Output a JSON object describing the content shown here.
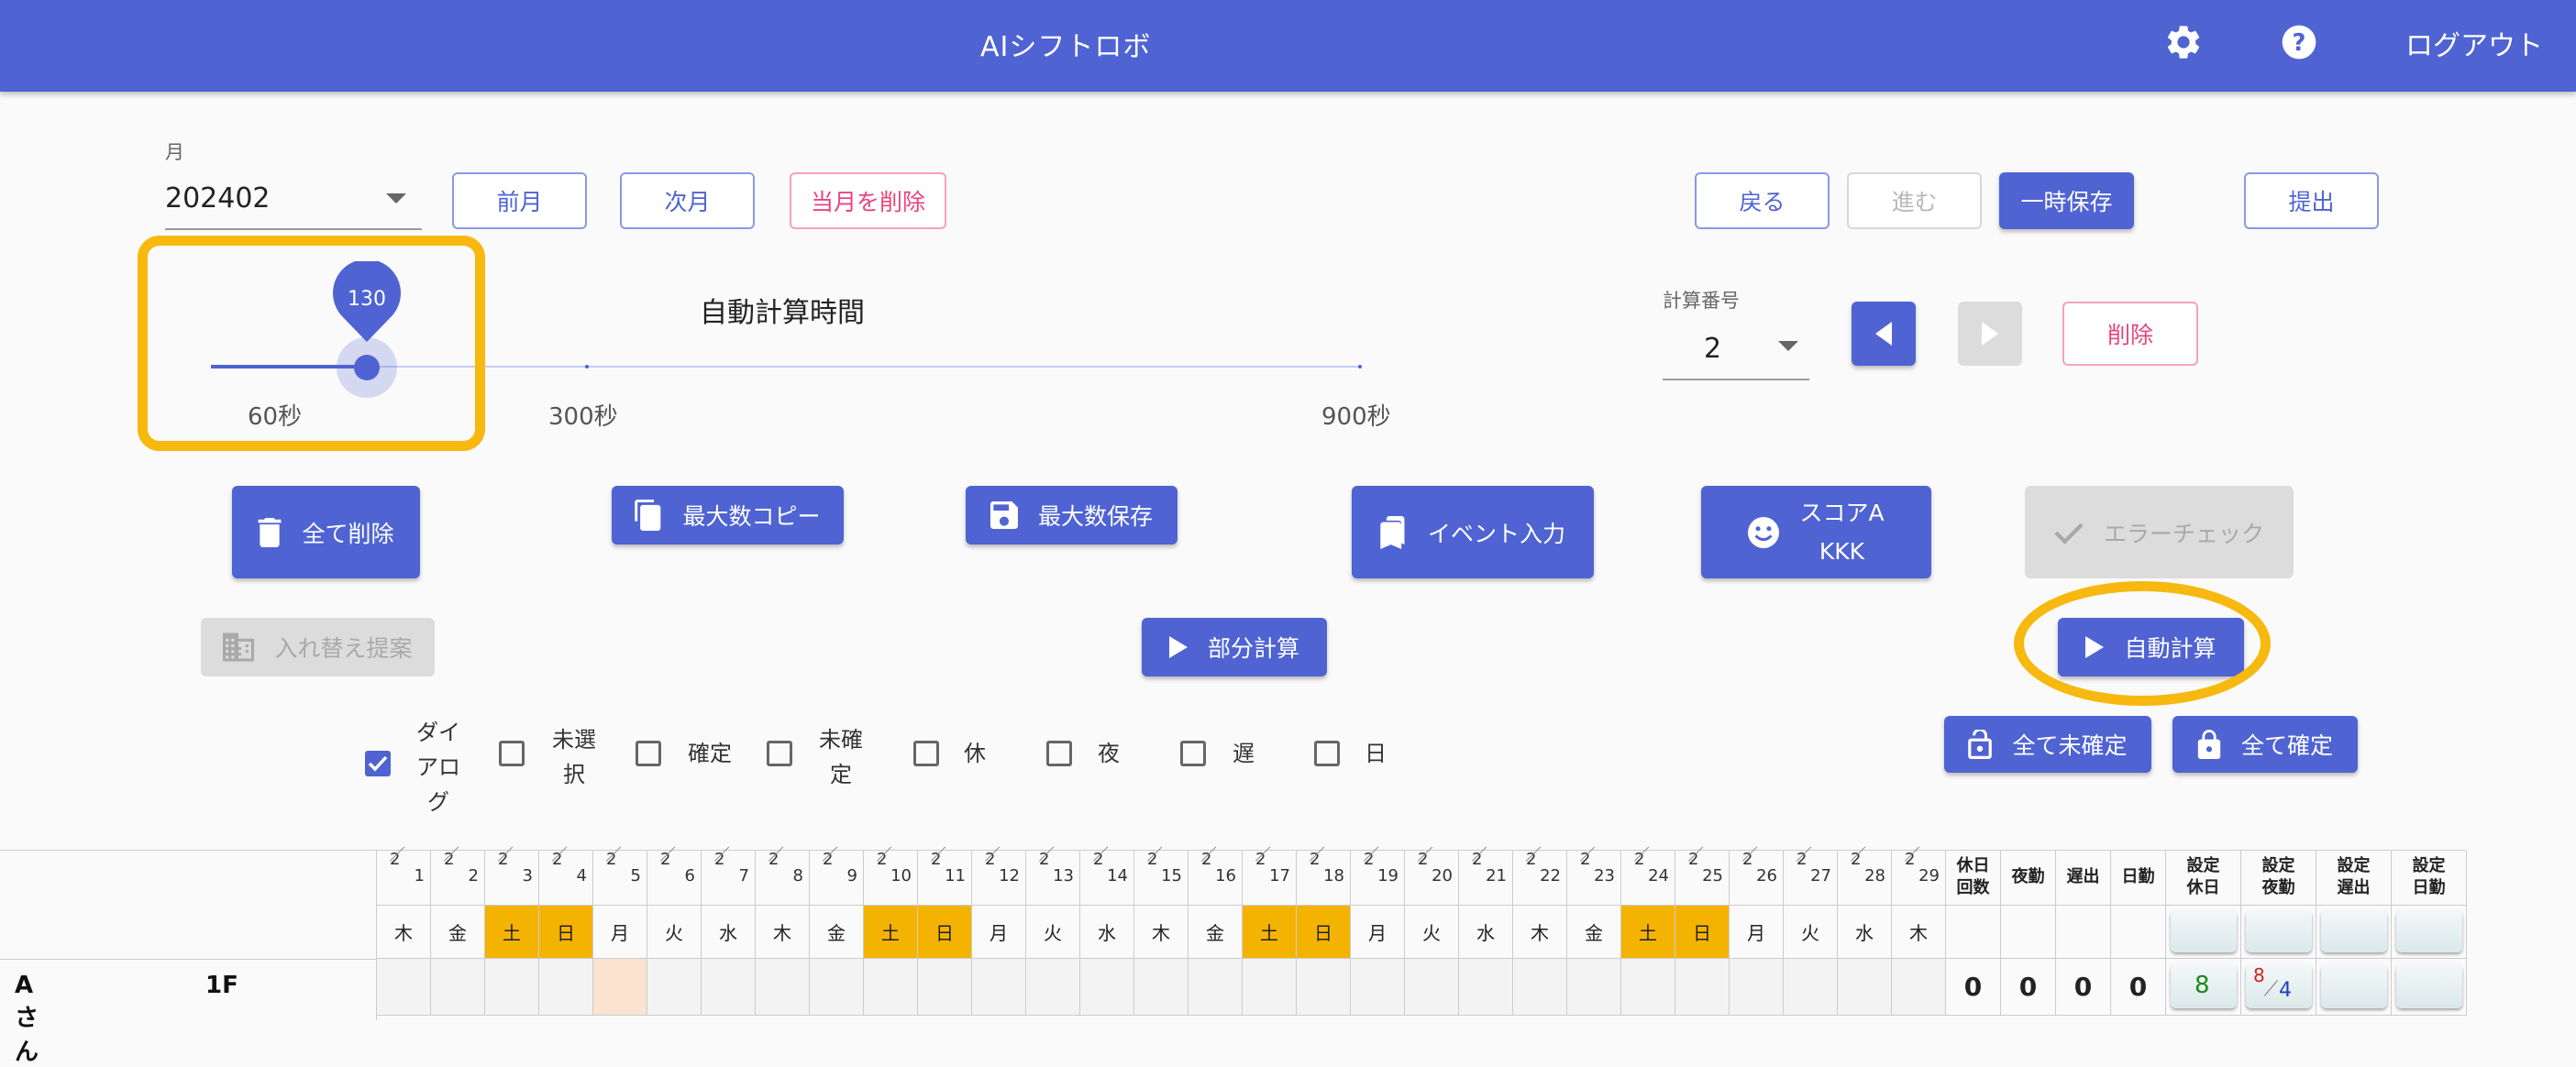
{
  "header": {
    "title": "AIシフトロボ",
    "logout": "ログアウト",
    "icons": [
      "gear-icon",
      "help-icon"
    ]
  },
  "month": {
    "label": "月",
    "value": "202402"
  },
  "nav": {
    "prev_month": "前月",
    "next_month": "次月",
    "delete_month": "当月を削除",
    "back": "戻る",
    "forward": "進む",
    "temp_save": "一時保存",
    "submit": "提出"
  },
  "slider": {
    "title": "自動計算時間",
    "value": "130",
    "min_label": "60秒",
    "mid_label": "300秒",
    "max_label": "900秒",
    "min": 60,
    "max": 900,
    "current": 130
  },
  "calc": {
    "label": "計算番号",
    "value": "2",
    "delete": "削除"
  },
  "actions": {
    "delete_all": "全て削除",
    "copy_max": "最大数コピー",
    "save_max": "最大数保存",
    "event_input": "イベント入力",
    "score_line1": "スコアA",
    "score_line2": "KKK",
    "error_check": "エラーチェック",
    "swap_suggest": "入れ替え提案",
    "partial_calc": "部分計算",
    "auto_calc": "自動計算",
    "unconfirm_all": "全て未確定",
    "confirm_all": "全て確定"
  },
  "filters": [
    {
      "label": "ダイアログ",
      "checked": true
    },
    {
      "label": "未選択",
      "checked": false
    },
    {
      "label": "確定",
      "checked": false
    },
    {
      "label": "未確定",
      "checked": false
    },
    {
      "label": "休",
      "checked": false
    },
    {
      "label": "夜",
      "checked": false
    },
    {
      "label": "遅",
      "checked": false
    },
    {
      "label": "日",
      "checked": false
    }
  ],
  "table": {
    "month_num": "2",
    "days": [
      "1",
      "2",
      "3",
      "4",
      "5",
      "6",
      "7",
      "8",
      "9",
      "10",
      "11",
      "12",
      "13",
      "14",
      "15",
      "16",
      "17",
      "18",
      "19",
      "20",
      "21",
      "22",
      "23",
      "24",
      "25",
      "26",
      "27",
      "28",
      "29"
    ],
    "weekdays": [
      "木",
      "金",
      "土",
      "日",
      "月",
      "火",
      "水",
      "木",
      "金",
      "土",
      "日",
      "月",
      "火",
      "水",
      "木",
      "金",
      "土",
      "日",
      "月",
      "火",
      "水",
      "木",
      "金",
      "土",
      "日",
      "月",
      "火",
      "水",
      "木"
    ],
    "weekend_color": "#f5b301",
    "summary_headers": [
      "休日回数",
      "夜勤",
      "遅出",
      "日勤",
      "設定休日",
      "設定夜勤",
      "設定遅出",
      "設定日勤"
    ],
    "row": {
      "name": "Aさん",
      "floor": "1F",
      "counts": [
        "0",
        "0",
        "0",
        "0"
      ],
      "set_holiday": "8",
      "set_night_top": "8",
      "set_night_bottom": "4"
    }
  },
  "colors": {
    "primary": "#4f63d2",
    "highlight": "#f7b80f",
    "danger": "#e8457a"
  }
}
